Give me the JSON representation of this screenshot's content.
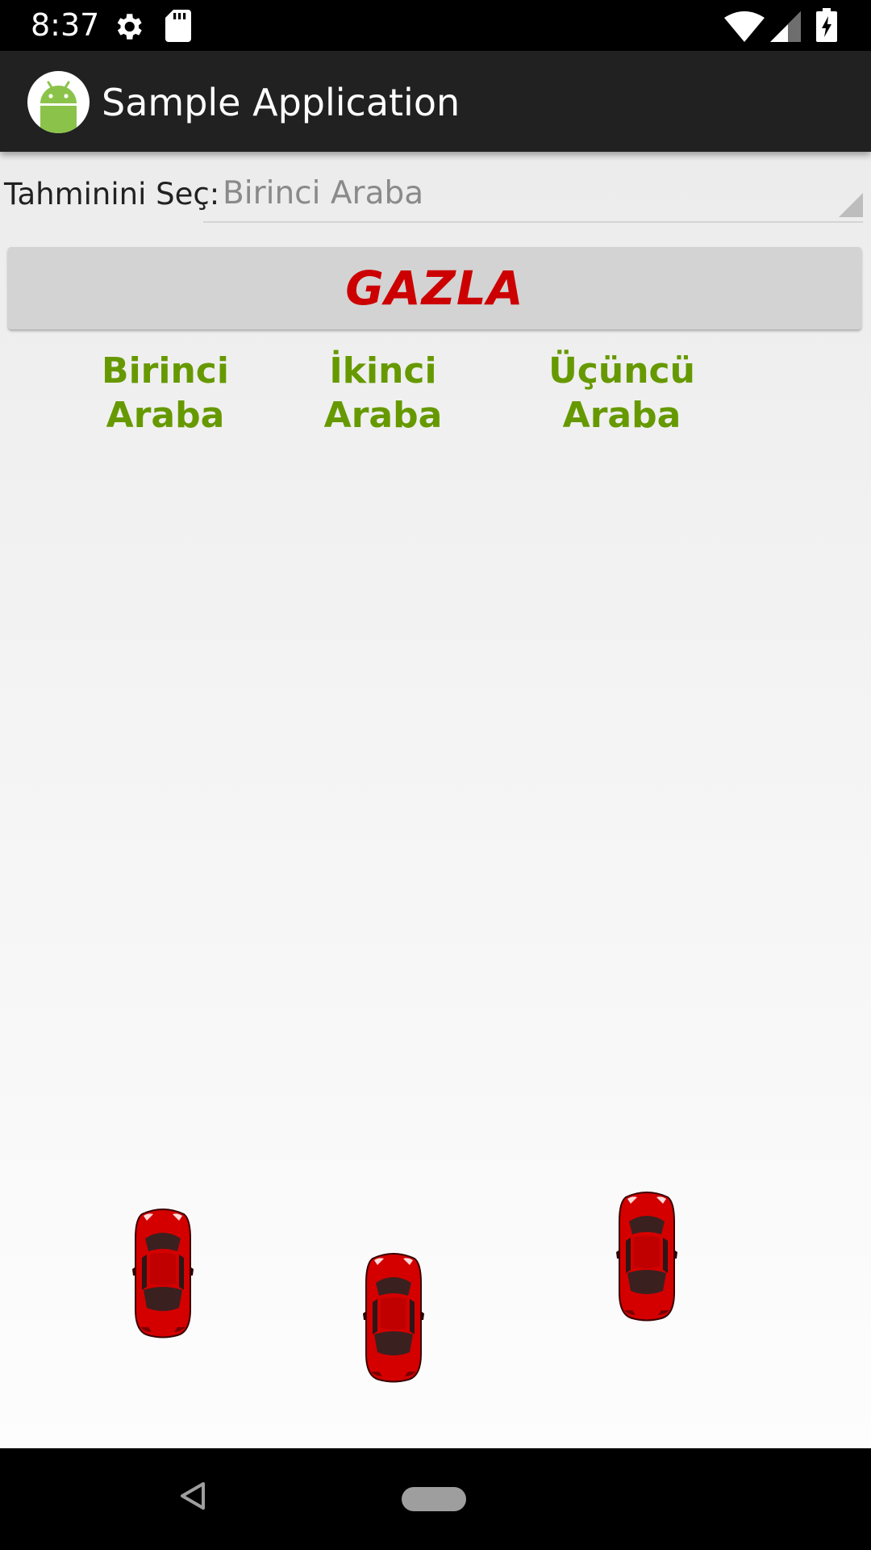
{
  "status_bar": {
    "time": "8:37",
    "icons": [
      "gear-icon",
      "sd-card-icon",
      "wifi-icon",
      "cell-signal-icon",
      "battery-charging-icon"
    ]
  },
  "app_bar": {
    "title": "Sample Application",
    "logo_icon": "android-logo-icon"
  },
  "prediction": {
    "label": "Tahminini Seç:",
    "selected_value": "Birinci Araba"
  },
  "start_button": {
    "label": "GAZLA",
    "text_color": "#cc0000",
    "background": "#d3d3d3"
  },
  "cars": [
    {
      "label_line1": "Birinci",
      "label_line2": "Araba",
      "icon": "red-car-icon"
    },
    {
      "label_line1": "İkinci",
      "label_line2": "Araba",
      "icon": "red-car-icon"
    },
    {
      "label_line1": "Üçüncü",
      "label_line2": "Araba",
      "icon": "red-car-icon"
    }
  ],
  "colors": {
    "label_green": "#669900",
    "car_red": "#cc0000"
  },
  "nav_bar": {
    "icons": [
      "back-icon",
      "home-pill-icon"
    ]
  }
}
